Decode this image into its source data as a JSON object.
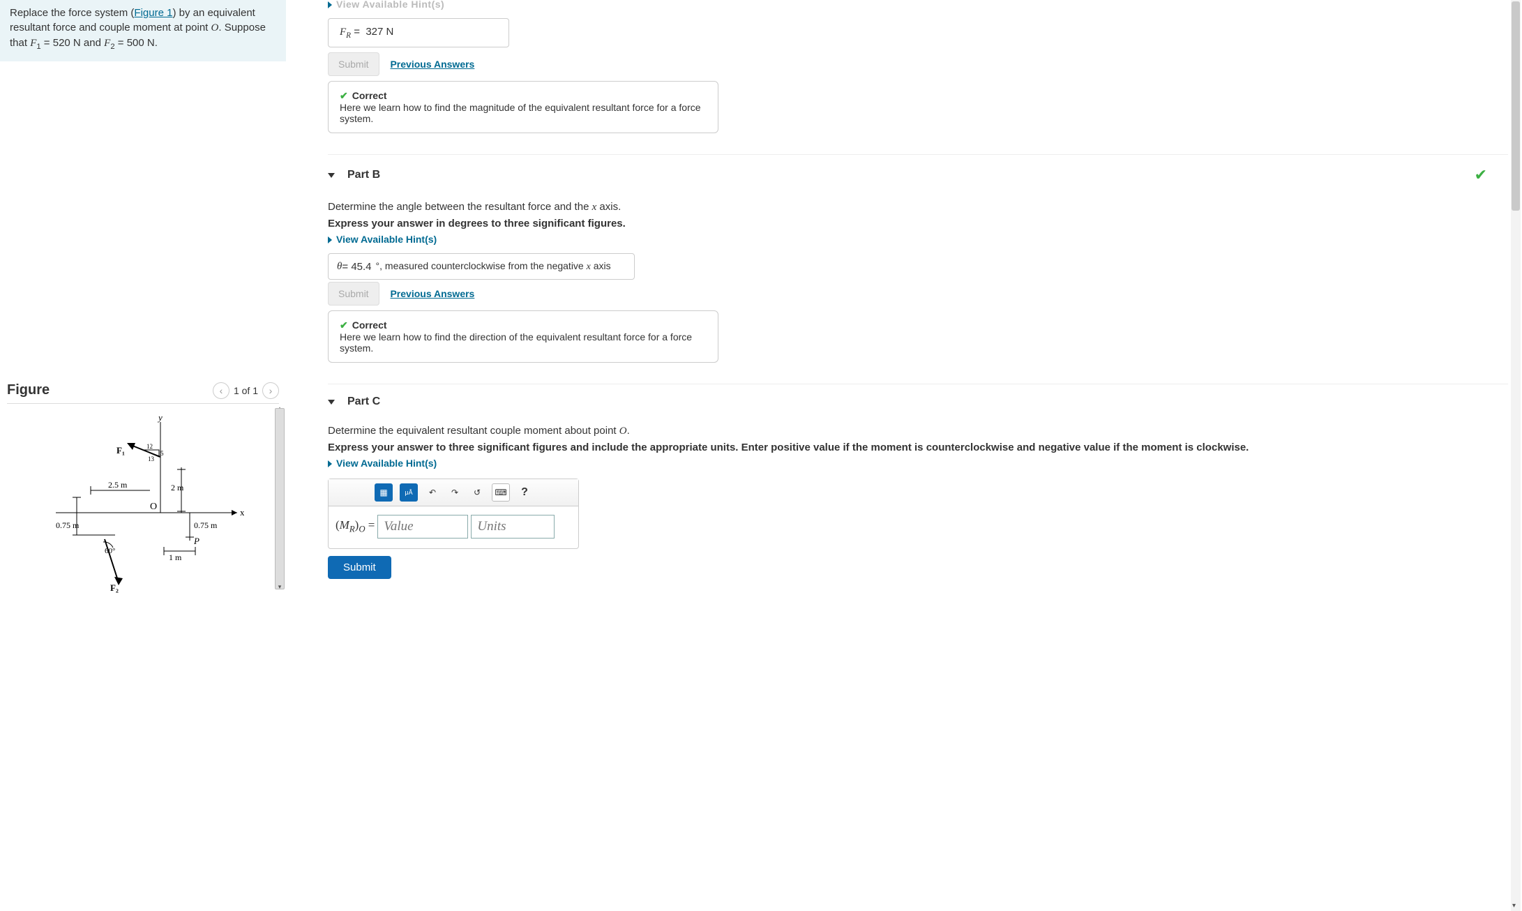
{
  "problem": {
    "text_pre": "Replace the force system (",
    "figure_link": "Figure 1",
    "text_mid": ") by an equivalent resultant force and couple moment at point ",
    "pointO": "O",
    "text_suppose": ". Suppose that ",
    "F1lab": "F",
    "F1sub": "1",
    "eq": " = ",
    "F1val": "520 N",
    "and": " and ",
    "F2lab": "F",
    "F2sub": "2",
    "F2val": "500 N",
    "period": "."
  },
  "figure": {
    "title": "Figure",
    "pager": "1 of 1",
    "labels": {
      "y": "y",
      "x": "x",
      "O": "O",
      "P": "P",
      "F1": "F₁",
      "F2": "F₂",
      "d25": "2.5 m",
      "d2m": "2 m",
      "d075a": "0.75 m",
      "d075b": "0.75 m",
      "d1m": "1 m",
      "ang60": "60°",
      "t12": "12",
      "t5": "5",
      "t13": "13"
    }
  },
  "partA": {
    "hint_cut": "View Available Hint(s)",
    "ans_prefix": "F",
    "ans_sub": "R",
    "ans_eq": " = ",
    "ans_val": "327 N",
    "submit": "Submit",
    "prev": "Previous Answers",
    "fb_title": "Correct",
    "fb_text": "Here we learn how to find the magnitude of the equivalent resultant force for a force system."
  },
  "partB": {
    "header": "Part B",
    "q": "Determine the angle between the resultant force and the ",
    "xaxis": "x",
    "q2": " axis.",
    "instr": "Express your answer in degrees to three significant figures.",
    "hint": "View Available Hint(s)",
    "theta": "θ",
    "eq": " = ",
    "val": "45.4",
    "note_deg": "°",
    "note1": ", measured counterclockwise from the negative ",
    "note_x": "x",
    "note2": " axis",
    "submit": "Submit",
    "prev": "Previous Answers",
    "fb_title": "Correct",
    "fb_text": "Here we learn how to find the direction of the equivalent resultant force for a force system."
  },
  "partC": {
    "header": "Part C",
    "q": "Determine the equivalent resultant couple moment about point ",
    "O": "O",
    "period": ".",
    "instr": "Express your answer to three significant figures and include the appropriate units. Enter positive value if the moment is counterclockwise and negative value if the moment is clockwise.",
    "hint": "View Available Hint(s)",
    "eq_lhs_open": "(",
    "eq_M": "M",
    "eq_Rsub": "R",
    "eq_close": ")",
    "eq_Osub": "O",
    "eq_eq": " = ",
    "value_ph": "Value",
    "units_ph": "Units",
    "tb_help": "?",
    "submit": "Submit"
  }
}
